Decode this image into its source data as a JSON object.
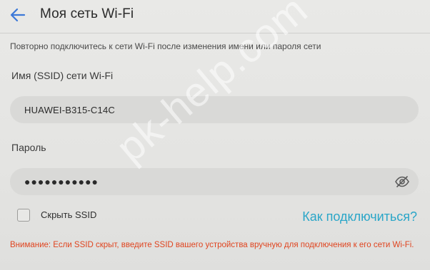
{
  "header": {
    "title": "Моя сеть Wi-Fi",
    "back_icon": "arrow-left-icon"
  },
  "note": "Повторно подключитесь к сети Wi-Fi после изменения имени или пароля сети",
  "ssid": {
    "label": "Имя (SSID) сети Wi-Fi",
    "value": "HUAWEI-B315-C14C"
  },
  "password": {
    "label": "Пароль",
    "value_masked": "●●●●●●●●●●●",
    "toggle_icon": "eye-off-icon"
  },
  "hide_ssid": {
    "label": "Скрыть SSID",
    "checked": false
  },
  "how_to_connect_link": "Как подключиться?",
  "warning": "Внимание: Если SSID скрыт, введите SSID вашего устройства вручную для подключения к его сети Wi-Fi.",
  "watermark": "pk-help.com",
  "colors": {
    "accent": "#2aa6c8",
    "back_arrow": "#3b78d8",
    "warning": "#e0441f"
  }
}
